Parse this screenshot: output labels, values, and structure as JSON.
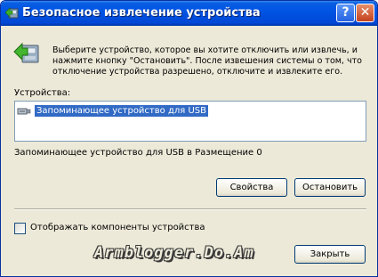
{
  "window": {
    "title": "Безопасное извлечение устройства",
    "help_label": "?",
    "close_label": "✕"
  },
  "description": "Выберите устройство, которое вы хотите отключить или извлечь, и нажмите кнопку \"Остановить\". После извешения системы о том, что отключение устройства разрешено, отключите и извлеките его.",
  "devices_label": "Устройства:",
  "devices": [
    {
      "label": "Запоминающее устройство для USB",
      "icon": "usb-icon",
      "selected": true
    }
  ],
  "location_text": "Запоминающее устройство для USB в Размещение 0",
  "buttons": {
    "properties": "Свойства",
    "stop": "Остановить",
    "close": "Закрыть"
  },
  "show_components": {
    "label": "Отображать компоненты устройства",
    "checked": false
  },
  "watermark": "Armblogger.Do.Am",
  "colors": {
    "titlebar": "#0054e3",
    "dialog_bg": "#ece9d8",
    "selection": "#316ac5"
  }
}
